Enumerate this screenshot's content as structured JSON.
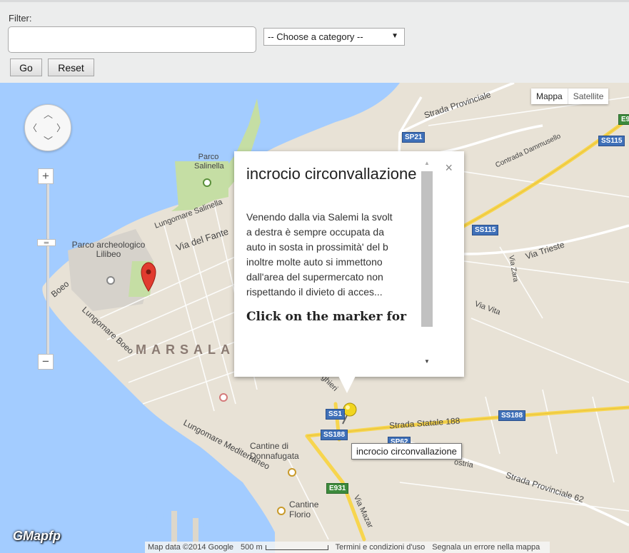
{
  "form": {
    "filter_label": "Filter:",
    "filter_value": "",
    "category_selected": "-- Choose a category --",
    "go_label": "Go",
    "reset_label": "Reset"
  },
  "map": {
    "type_map": "Mappa",
    "type_satellite": "Satellite",
    "labels": {
      "parco_salinella": "Parco Salinella",
      "lungomare_salinella": "Lungomare Salinella",
      "via_fante": "Via del Fante",
      "parco_lilibeo": "Parco archeologico Lilibeo",
      "boeo": "Boeo",
      "lungomare_boeo": "Lungomare Boeo",
      "marsala": "MARSALA",
      "lungomare_mediterraneo": "Lungomare Mediterraneo",
      "cantine_donnafugata": "Cantine di Donnafugata",
      "cantine_florio": "Cantine Florio",
      "strada_provinciale": "Strada Provinciale",
      "contrada_dammusello": "Contrada Dammusello",
      "via_trieste": "Via Trieste",
      "via_zara": "Via Zara",
      "via_vita": "Via Vita",
      "strada_statale_188": "Strada Statale 188",
      "strada_provinciale_62": "Strada Provinciale 62",
      "via_mazara": "Via Mazar",
      "ghieri": "ghieri",
      "ostria": "ostria"
    },
    "shields": {
      "sp21": "SP21",
      "ss115_a": "SS115",
      "ss115_b": "SS115",
      "e9": "E9",
      "ss188_a": "SS188",
      "ss188_b": "SS188",
      "ss1": "SS1",
      "sp62": "SP62",
      "e931": "E931"
    },
    "footer": {
      "data": "Map data ©2014 Google",
      "scale": "500 m",
      "terms": "Termini e condizioni d'uso",
      "report": "Segnala un errore nella mappa"
    },
    "logo": "GMapfp",
    "colors": {
      "water": "#a3ccff",
      "land": "#e8e2d6",
      "park": "#c5dea4",
      "highway": "#f7d54e",
      "marker_red": "#e13b2f",
      "marker_yellow": "#f1d51f"
    }
  },
  "infowindow": {
    "title": "incrocio circonvallazione",
    "desc_lines": [
      "Venendo dalla via Salemi la svolt",
      "a destra è sempre occupata da",
      "auto in sosta in prossimità' del b",
      "inoltre molte auto si immettono",
      "dall'area del supermercato non",
      "rispettando il divieto di acces..."
    ],
    "cta": "Click on the marker for"
  },
  "tooltip": "incrocio circonvallazione"
}
